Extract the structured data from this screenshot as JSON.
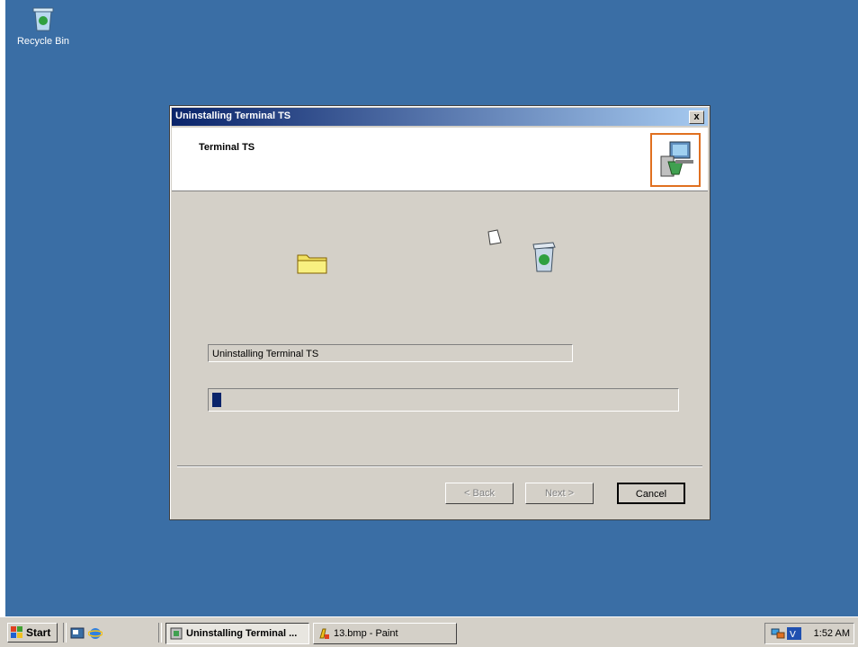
{
  "desktop": {
    "icons": [
      {
        "label": "Recycle Bin",
        "icon": "recycle-bin-icon"
      }
    ]
  },
  "dialog": {
    "title": "Uninstalling Terminal TS",
    "close_label": "x",
    "header_title": "Terminal TS",
    "header_icon": "setup-computer-icon",
    "status_text": "Uninstalling Terminal TS",
    "progress_fraction": 0.02,
    "buttons": {
      "back": "< Back",
      "next": "Next >",
      "cancel": "Cancel"
    }
  },
  "taskbar": {
    "start_label": "Start",
    "quick_launch": [
      "desktop-icon",
      "ie-icon"
    ],
    "tasks": [
      {
        "label": "Uninstalling Terminal ...",
        "active": true
      },
      {
        "label": "13.bmp - Paint",
        "active": false
      }
    ],
    "clock": "1:52 AM"
  }
}
